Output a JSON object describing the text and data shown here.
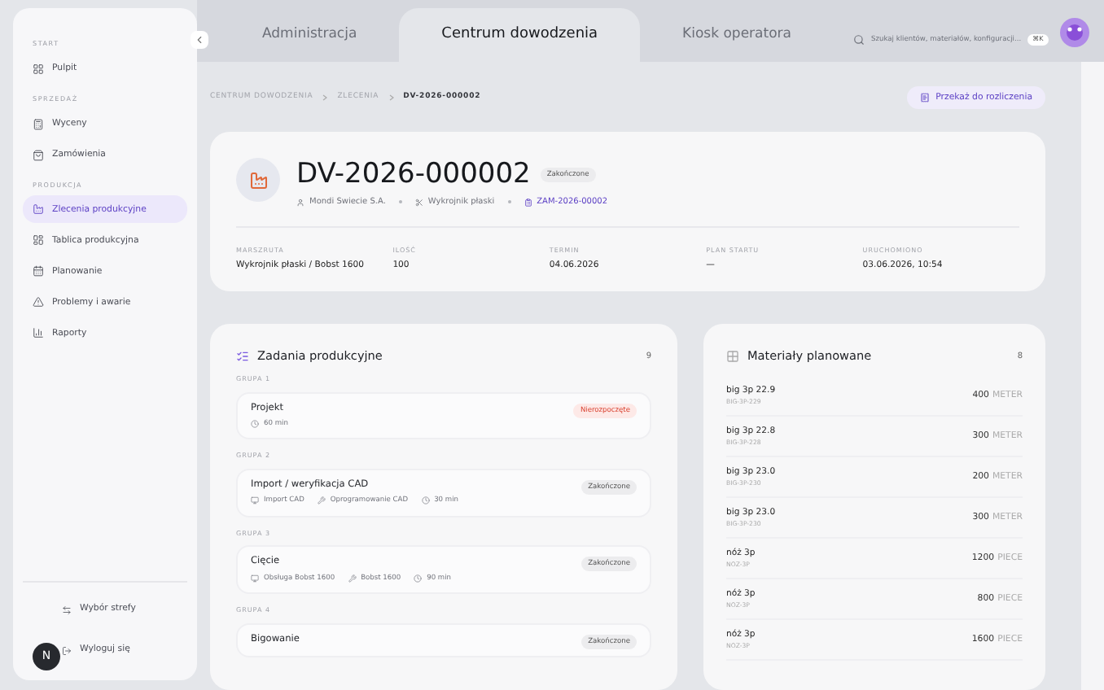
{
  "sidebar": {
    "sections": [
      {
        "title": "START",
        "items": [
          {
            "label": "Pulpit",
            "kind": "grid",
            "selected": false
          }
        ]
      },
      {
        "title": "SPRZEDAŻ",
        "items": [
          {
            "label": "Wyceny",
            "kind": "calc",
            "selected": false
          },
          {
            "label": "Zamówienia",
            "kind": "bag",
            "selected": false
          }
        ]
      },
      {
        "title": "PRODUKCJA",
        "items": [
          {
            "label": "Zlecenia produkcyjne",
            "kind": "factory",
            "selected": true
          },
          {
            "label": "Tablica produkcyjna",
            "kind": "board",
            "selected": false
          },
          {
            "label": "Planowanie",
            "kind": "calendar",
            "selected": false
          },
          {
            "label": "Problemy i awarie",
            "kind": "alert",
            "selected": false
          },
          {
            "label": "Raporty",
            "kind": "chart",
            "selected": false
          }
        ]
      }
    ],
    "footer": [
      {
        "label": "Wybór strefy",
        "kind": "swap"
      },
      {
        "label": "Wyloguj się",
        "kind": "logout"
      }
    ],
    "avatar": "N"
  },
  "tabs": [
    {
      "label": "Administracja",
      "selected": false
    },
    {
      "label": "Centrum dowodzenia",
      "selected": true
    },
    {
      "label": "Kiosk operatora",
      "selected": false
    }
  ],
  "search": {
    "placeholder": "Szukaj klientów, materiałów, konfiguracji...",
    "shortcut": "⌘K"
  },
  "breadcrumb": [
    "CENTRUM DOWODZENIA",
    "ZLECENIA",
    "DV-2026-000002"
  ],
  "action": "Przekaż do rozliczenia",
  "order": {
    "number": "DV-2026-000002",
    "status": "Zakończone",
    "customer": "Mondi Swiecie S.A.",
    "machine": "Wykrojnik płaski",
    "link": "ZAM-2026-00002",
    "fields": [
      {
        "label": "MARSZRUTA",
        "value": "Wykrojnik płaski / Bobst 1600"
      },
      {
        "label": "ILOŚĆ",
        "value": "100"
      },
      {
        "label": "TERMIN",
        "value": "04.06.2026"
      },
      {
        "label": "PLAN STARTU",
        "value": "—"
      },
      {
        "label": "URUCHOMIONO",
        "value": "03.06.2026, 10:54"
      }
    ]
  },
  "tasks": {
    "title": "Zadania produkcyjne",
    "count": "9",
    "groups": [
      {
        "label": "GRUPA 1",
        "name": "Projekt",
        "status": "Nierozpoczęte",
        "kind": "pending",
        "meta": [
          {
            "kind": "clock",
            "text": "60 min"
          }
        ]
      },
      {
        "label": "GRUPA 2",
        "name": "Import / weryfikacja CAD",
        "status": "Zakończone",
        "kind": "done",
        "meta": [
          {
            "kind": "station",
            "text": "Import CAD"
          },
          {
            "kind": "tool",
            "text": "Oprogramowanie CAD"
          },
          {
            "kind": "clock",
            "text": "30 min"
          }
        ]
      },
      {
        "label": "GRUPA 3",
        "name": "Cięcie",
        "status": "Zakończone",
        "kind": "done",
        "meta": [
          {
            "kind": "station",
            "text": "Obsługa Bobst 1600"
          },
          {
            "kind": "tool",
            "text": "Bobst 1600"
          },
          {
            "kind": "clock",
            "text": "90 min"
          }
        ]
      },
      {
        "label": "GRUPA 4",
        "name": "Bigowanie",
        "status": "Zakończone",
        "kind": "done"
      }
    ]
  },
  "materials": {
    "title": "Materiały planowane",
    "count": "8",
    "rows": [
      {
        "name": "big 3p 22.9",
        "code": "BIG-3P-229",
        "qty": "400",
        "unit": "METER"
      },
      {
        "name": "big 3p 22.8",
        "code": "BIG-3P-228",
        "qty": "300",
        "unit": "METER"
      },
      {
        "name": "big 3p 23.0",
        "code": "BIG-3P-230",
        "qty": "200",
        "unit": "METER"
      },
      {
        "name": "big 3p 23.0",
        "code": "BIG-3P-230",
        "qty": "300",
        "unit": "METER"
      },
      {
        "name": "nóż 3p",
        "code": "NOZ-3P",
        "qty": "1200",
        "unit": "PIECE"
      },
      {
        "name": "nóż 3p",
        "code": "NOZ-3P",
        "qty": "800",
        "unit": "PIECE"
      },
      {
        "name": "nóż 3p",
        "code": "NOZ-3P",
        "qty": "1600",
        "unit": "PIECE"
      }
    ]
  }
}
